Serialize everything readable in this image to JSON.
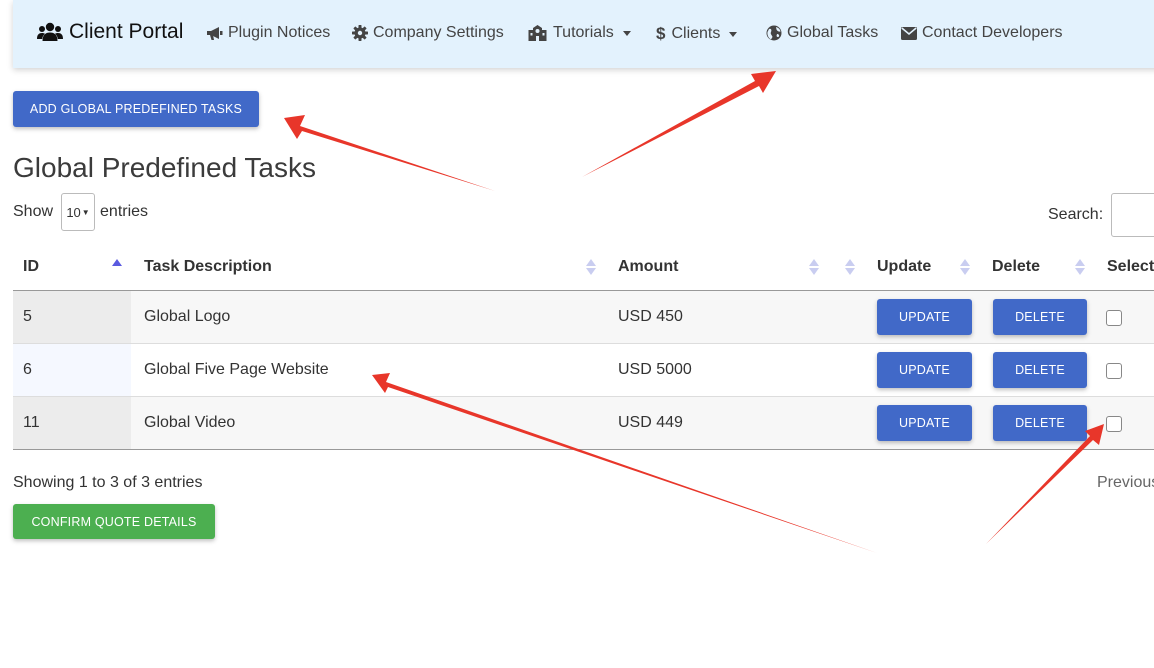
{
  "navbar": {
    "brand": "Client Portal",
    "items": [
      {
        "label": "Plugin Notices",
        "icon": "megaphone-icon"
      },
      {
        "label": "Company Settings",
        "icon": "gear-icon"
      },
      {
        "label": "Tutorials",
        "icon": "school-icon",
        "dropdown": true
      },
      {
        "label": "Clients",
        "icon": "dollar-icon",
        "dropdown": true
      },
      {
        "label": "Global Tasks",
        "icon": "globe-icon"
      },
      {
        "label": "Contact Developers",
        "icon": "envelope-icon"
      }
    ]
  },
  "add_button": "ADD GLOBAL PREDEFINED TASKS",
  "page_title": "Global Predefined Tasks",
  "length_menu": {
    "show": "Show",
    "value": "10",
    "entries": "entries"
  },
  "search_label": "Search:",
  "table": {
    "headers": {
      "id": "ID",
      "description": "Task Description",
      "amount": "Amount",
      "update": "Update",
      "delete": "Delete",
      "select": "Select"
    },
    "rows": [
      {
        "id": "5",
        "description": "Global Logo",
        "amount": "USD 450",
        "update": "UPDATE",
        "delete": "DELETE"
      },
      {
        "id": "6",
        "description": "Global Five Page Website",
        "amount": "USD 5000",
        "update": "UPDATE",
        "delete": "DELETE"
      },
      {
        "id": "11",
        "description": "Global Video",
        "amount": "USD 449",
        "update": "UPDATE",
        "delete": "DELETE"
      }
    ]
  },
  "info": "Showing 1 to 3 of 3 entries",
  "previous": "Previous",
  "confirm_button": "CONFIRM QUOTE DETAILS",
  "colors": {
    "nav_bg": "#e3f2fd",
    "primary": "#4169c8",
    "success": "#4caf50",
    "annotation": "#e8362a"
  }
}
